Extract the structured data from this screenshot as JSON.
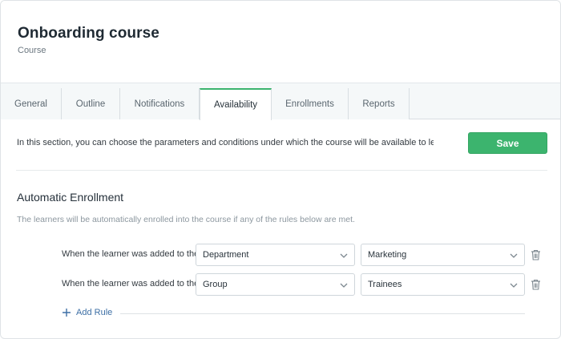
{
  "header": {
    "title": "Onboarding course",
    "subtitle": "Course"
  },
  "tabs": [
    {
      "label": "General"
    },
    {
      "label": "Outline"
    },
    {
      "label": "Notifications"
    },
    {
      "label": "Availability",
      "active": true
    },
    {
      "label": "Enrollments"
    },
    {
      "label": "Reports"
    }
  ],
  "availability": {
    "intro": "In this section, you can choose the parameters and conditions under which the course will be available to learners.",
    "save_label": "Save",
    "section_title": "Automatic Enrollment",
    "section_desc": "The learners will be automatically enrolled into the course if any of the rules below are met.",
    "rules": [
      {
        "condition": "When the learner was added to the",
        "type": "Department",
        "value": "Marketing"
      },
      {
        "condition": "When the learner was added to the",
        "type": "Group",
        "value": "Trainees"
      }
    ],
    "add_rule_label": "Add Rule"
  },
  "colors": {
    "accent": "#3cb46e",
    "link": "#3d6fa5"
  },
  "icons": {
    "dropdown": "chevron-down-icon",
    "delete": "trash-icon",
    "add": "plus-icon"
  }
}
